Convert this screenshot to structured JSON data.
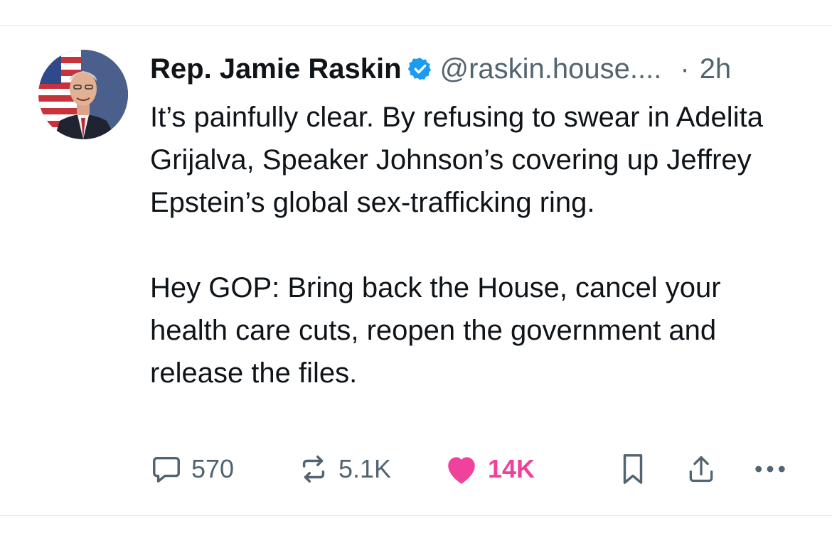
{
  "post": {
    "author_name": "Rep. Jamie Raskin",
    "handle": "@raskin.house....",
    "separator": "·",
    "time": "2h",
    "body": [
      "It’s painfully clear. By refusing to swear in Adelita Grijalva, Speaker Johnson’s covering up Jeffrey Epstein’s global sex-trafficking ring.",
      "Hey GOP: Bring back the House, cancel your health care cuts, reopen the government and release the files."
    ]
  },
  "actions": {
    "replies": "570",
    "reposts": "5.1K",
    "likes": "14K",
    "liked": true
  },
  "icons": {
    "verified": "verified-badge-icon",
    "reply": "speech-bubble-icon",
    "repost": "repost-arrows-icon",
    "like": "heart-icon",
    "bookmark": "bookmark-icon",
    "share": "share-icon",
    "more": "more-dots-icon"
  },
  "colors": {
    "text": "#0f1419",
    "secondary": "#536471",
    "verified": "#1d9bf0",
    "like": "#f0419b",
    "divider": "#e3e6ea"
  }
}
